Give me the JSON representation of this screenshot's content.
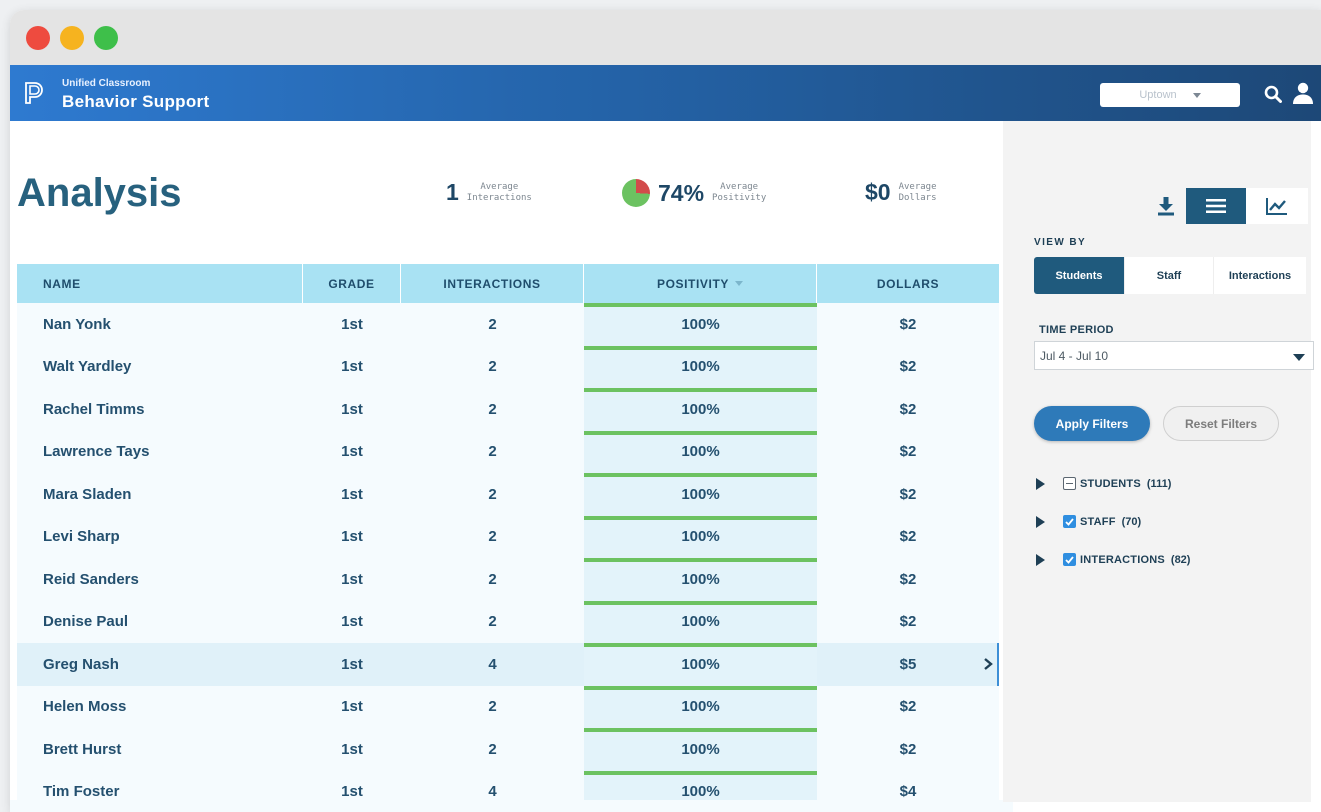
{
  "app": {
    "brand_sub": "Unified Classroom",
    "brand_main": "Behavior Support",
    "school_select": "Uptown"
  },
  "page": {
    "title": "Analysis"
  },
  "stats": [
    {
      "value": "1",
      "label_line1": "Average",
      "label_line2": "Interactions"
    },
    {
      "value": "74%",
      "label_line1": "Average",
      "label_line2": "Positivity",
      "positive_fraction": 0.74
    },
    {
      "value": "$0",
      "label_line1": "Average",
      "label_line2": "Dollars"
    }
  ],
  "table": {
    "columns": [
      "NAME",
      "GRADE",
      "INTERACTIONS",
      "POSITIVITY",
      "DOLLARS"
    ],
    "rows": [
      {
        "name": "Nan Yonk",
        "grade": "1st",
        "interactions": "2",
        "positivity": "100%",
        "dollars": "$2"
      },
      {
        "name": "Walt Yardley",
        "grade": "1st",
        "interactions": "2",
        "positivity": "100%",
        "dollars": "$2"
      },
      {
        "name": "Rachel Timms",
        "grade": "1st",
        "interactions": "2",
        "positivity": "100%",
        "dollars": "$2"
      },
      {
        "name": "Lawrence Tays",
        "grade": "1st",
        "interactions": "2",
        "positivity": "100%",
        "dollars": "$2"
      },
      {
        "name": "Mara Sladen",
        "grade": "1st",
        "interactions": "2",
        "positivity": "100%",
        "dollars": "$2"
      },
      {
        "name": "Levi Sharp",
        "grade": "1st",
        "interactions": "2",
        "positivity": "100%",
        "dollars": "$2"
      },
      {
        "name": "Reid Sanders",
        "grade": "1st",
        "interactions": "2",
        "positivity": "100%",
        "dollars": "$2"
      },
      {
        "name": "Denise Paul",
        "grade": "1st",
        "interactions": "2",
        "positivity": "100%",
        "dollars": "$2"
      },
      {
        "name": "Greg Nash",
        "grade": "1st",
        "interactions": "4",
        "positivity": "100%",
        "dollars": "$5"
      },
      {
        "name": "Helen Moss",
        "grade": "1st",
        "interactions": "2",
        "positivity": "100%",
        "dollars": "$2"
      },
      {
        "name": "Brett Hurst",
        "grade": "1st",
        "interactions": "2",
        "positivity": "100%",
        "dollars": "$2"
      },
      {
        "name": "Tim Foster",
        "grade": "1st",
        "interactions": "4",
        "positivity": "100%",
        "dollars": "$4"
      }
    ],
    "selected_row": "Greg Nash",
    "positivity_fill": 1.0
  },
  "sidebar": {
    "view_by_label": "VIEW BY",
    "view_by_options": [
      "Students",
      "Staff",
      "Interactions"
    ],
    "view_by_selected": "Students",
    "time_period_label": "TIME PERIOD",
    "time_period_value": "Jul 4 - Jul 10",
    "apply_label": "Apply Filters",
    "reset_label": "Reset Filters",
    "filters": [
      {
        "label": "STUDENTS",
        "count": "(111)",
        "state": "indeterminate"
      },
      {
        "label": "STAFF",
        "count": "(70)",
        "state": "checked"
      },
      {
        "label": "INTERACTIONS",
        "count": "(82)",
        "state": "checked"
      }
    ]
  },
  "colors": {
    "brand_dark": "#1f5a7d",
    "accent_green": "#6cc261",
    "accent_red": "#d24b4b",
    "header_blue": "#a9e2f3"
  }
}
